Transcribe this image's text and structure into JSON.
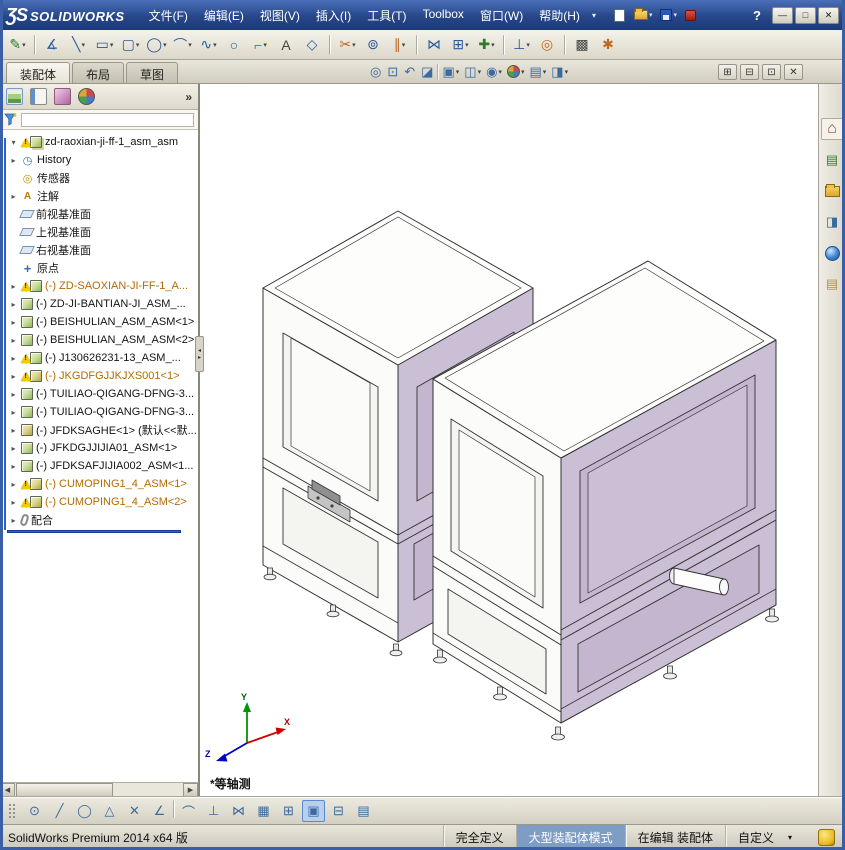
{
  "colors": {
    "titlebar_blue": "#27478a",
    "accent_blue": "#2f5fd0",
    "model_lavender": "#cbbfd6",
    "warning_yellow": "#f5c800"
  },
  "titlebar": {
    "logo_mark": "ƷS",
    "logo_text": "SOLIDWORKS",
    "menu_caret": "▾",
    "help_label": "?",
    "menus": [
      {
        "label": "文件(F)"
      },
      {
        "label": "编辑(E)"
      },
      {
        "label": "视图(V)"
      },
      {
        "label": "插入(I)"
      },
      {
        "label": "工具(T)"
      },
      {
        "label": "Toolbox"
      },
      {
        "label": "窗口(W)"
      },
      {
        "label": "帮助(H)"
      }
    ],
    "quick_icons": [
      {
        "name": "new-document-button",
        "cls": "qi-page",
        "caret": ""
      },
      {
        "name": "open-button",
        "cls": "qi-folder",
        "caret": "▾"
      },
      {
        "name": "save-button",
        "cls": "qi-floppy",
        "caret": "▾"
      },
      {
        "name": "record-status-icon",
        "cls": "qi-red",
        "caret": "",
        "inter": "false"
      }
    ],
    "window_buttons": [
      {
        "name": "minimize-button",
        "glyph": "—"
      },
      {
        "name": "maximize-button",
        "glyph": "□"
      },
      {
        "name": "close-button",
        "glyph": "✕"
      }
    ]
  },
  "toolbar": {
    "icons": [
      {
        "name": "sketch-button",
        "glyph": "✎",
        "caret": "▾",
        "cls": "c-green"
      },
      {
        "name": "toolbar-separator",
        "glyph": "",
        "caret": "",
        "cls": "sep",
        "inter": "false"
      },
      {
        "name": "smart-dimension-button",
        "glyph": "∡",
        "caret": "",
        "cls": "c-blue"
      },
      {
        "name": "line-button",
        "glyph": "╲",
        "caret": "▾",
        "cls": "c-blue"
      },
      {
        "name": "rectangle-button",
        "glyph": "▭",
        "caret": "▾",
        "cls": "c-blue"
      },
      {
        "name": "slot-button",
        "glyph": "▢",
        "caret": "▾",
        "cls": "c-blue"
      },
      {
        "name": "circle-button",
        "glyph": "◯",
        "caret": "▾",
        "cls": "c-blue"
      },
      {
        "name": "arc-button",
        "glyph": "⌒",
        "caret": "▾",
        "cls": "c-blue"
      },
      {
        "name": "spline-button",
        "glyph": "∿",
        "caret": "▾",
        "cls": "c-blue"
      },
      {
        "name": "ellipse-button",
        "glyph": "○",
        "caret": "",
        "cls": "c-blue"
      },
      {
        "name": "fillet-button",
        "glyph": "⌐",
        "caret": "▾",
        "cls": "c-orange"
      },
      {
        "name": "text-button",
        "glyph": "A",
        "caret": "",
        "cls": "c-dark"
      },
      {
        "name": "plane-button",
        "glyph": "◇",
        "caret": "",
        "cls": "c-blue"
      },
      {
        "name": "toolbar-separator",
        "glyph": "",
        "caret": "",
        "cls": "sep",
        "inter": "false"
      },
      {
        "name": "trim-entities-button",
        "glyph": "✂",
        "caret": "▾",
        "cls": "c-orange"
      },
      {
        "name": "convert-entities-button",
        "glyph": "⊚",
        "caret": "",
        "cls": "c-blue"
      },
      {
        "name": "offset-entities-button",
        "glyph": "∥",
        "caret": "▾",
        "cls": "c-orange"
      },
      {
        "name": "toolbar-separator",
        "glyph": "",
        "caret": "",
        "cls": "sep",
        "inter": "false"
      },
      {
        "name": "mirror-entities-button",
        "glyph": "⋈",
        "caret": "",
        "cls": "c-blue"
      },
      {
        "name": "linear-pattern-button",
        "glyph": "⊞",
        "caret": "▾",
        "cls": "c-blue"
      },
      {
        "name": "move-entities-button",
        "glyph": "✚",
        "caret": "▾",
        "cls": "c-green"
      },
      {
        "name": "toolbar-separator",
        "glyph": "",
        "caret": "",
        "cls": "sep",
        "inter": "false"
      },
      {
        "name": "display-relations-button",
        "glyph": "⊥",
        "caret": "▾",
        "cls": "c-blue"
      },
      {
        "name": "repair-sketch-button",
        "glyph": "◎",
        "caret": "",
        "cls": "c-orange"
      },
      {
        "name": "toolbar-separator",
        "glyph": "",
        "caret": "",
        "cls": "sep",
        "inter": "false"
      },
      {
        "name": "sketch-picture-button",
        "glyph": "▩",
        "caret": "",
        "cls": "c-dark"
      },
      {
        "name": "rapid-sketch-button",
        "glyph": "✱",
        "caret": "",
        "cls": "c-orange"
      }
    ]
  },
  "tabs": {
    "items": [
      {
        "label": "装配体",
        "cls": "active"
      },
      {
        "label": "布局",
        "cls": ""
      },
      {
        "label": "草图",
        "cls": ""
      }
    ]
  },
  "mdi_buttons": [
    {
      "name": "doc-new-window-button",
      "glyph": "⊞"
    },
    {
      "name": "doc-cascade-button",
      "glyph": "⊟"
    },
    {
      "name": "doc-restore-button",
      "glyph": "⊡"
    },
    {
      "name": "doc-close-button",
      "glyph": "✕"
    }
  ],
  "headsup": {
    "icons": [
      {
        "name": "zoom-fit-button",
        "glyph": "◎",
        "caret": "",
        "cls": ""
      },
      {
        "name": "zoom-area-button",
        "glyph": "⊡",
        "caret": "",
        "cls": ""
      },
      {
        "name": "previous-view-button",
        "glyph": "↶",
        "caret": "",
        "cls": ""
      },
      {
        "name": "section-view-button",
        "glyph": "◪",
        "caret": "",
        "cls": ""
      },
      {
        "name": "headsup-separator",
        "glyph": "",
        "caret": "",
        "cls": "sep",
        "inter": "false"
      },
      {
        "name": "view-orientation-button",
        "glyph": "▣",
        "caret": "▾",
        "cls": ""
      },
      {
        "name": "display-style-button",
        "glyph": "◫",
        "caret": "▾",
        "cls": ""
      },
      {
        "name": "hide-show-items-button",
        "glyph": "◉",
        "caret": "▾",
        "cls": ""
      },
      {
        "name": "edit-appearance-button",
        "glyph": "",
        "caret": "▾",
        "cls": "ball"
      },
      {
        "name": "apply-scene-button",
        "glyph": "▤",
        "caret": "▾",
        "cls": ""
      },
      {
        "name": "view-settings-button",
        "glyph": "◨",
        "caret": "▾",
        "cls": ""
      }
    ]
  },
  "panel_tabs": {
    "chevron": "»",
    "icons": [
      {
        "name": "featuremanager-tab",
        "cls": "pt-feat"
      },
      {
        "name": "propertymanager-tab",
        "cls": "pt-prop"
      },
      {
        "name": "configurationmanager-tab",
        "cls": "pt-conf"
      },
      {
        "name": "displaymanager-tab",
        "cls": "pt-disp"
      }
    ]
  },
  "tree": {
    "items": [
      {
        "arrow": "▾",
        "icon": "i-root",
        "cls": "warn",
        "label": "zd-raoxian-ji-ff-1_asm_asm"
      },
      {
        "arrow": "▸",
        "icon": "i-history",
        "cls": "",
        "label": "History"
      },
      {
        "arrow": "",
        "icon": "i-sensor",
        "cls": "",
        "label": "传感器"
      },
      {
        "arrow": "▸",
        "icon": "i-annot",
        "cls": "",
        "label": "注解"
      },
      {
        "arrow": "",
        "icon": "i-plane",
        "cls": "",
        "label": "前视基准面"
      },
      {
        "arrow": "",
        "icon": "i-plane",
        "cls": "",
        "label": "上视基准面"
      },
      {
        "arrow": "",
        "icon": "i-plane",
        "cls": "",
        "label": "右视基准面"
      },
      {
        "arrow": "",
        "icon": "i-origin",
        "cls": "",
        "label": "原点"
      },
      {
        "arrow": "▸",
        "icon": "i-asm",
        "cls": "warn orange",
        "label": "(-) ZD-SAOXIAN-JI-FF-1_A..."
      },
      {
        "arrow": "▸",
        "icon": "i-asm",
        "cls": "",
        "label": "(-) ZD-JI-BANTIAN-JI_ASM_..."
      },
      {
        "arrow": "▸",
        "icon": "i-asm",
        "cls": "",
        "label": "(-) BEISHULIAN_ASM_ASM<1>"
      },
      {
        "arrow": "▸",
        "icon": "i-asm",
        "cls": "",
        "label": "(-) BEISHULIAN_ASM_ASM<2>"
      },
      {
        "arrow": "▸",
        "icon": "i-asm",
        "cls": "warn",
        "label": "(-) J130626231-13_ASM_..."
      },
      {
        "arrow": "▸",
        "icon": "i-part",
        "cls": "warn orange",
        "label": "(-) JKGDFGJJKJXS001<1>"
      },
      {
        "arrow": "▸",
        "icon": "i-asm",
        "cls": "",
        "label": "(-) TUILIAO-QIGANG-DFNG-3..."
      },
      {
        "arrow": "▸",
        "icon": "i-asm",
        "cls": "",
        "label": "(-) TUILIAO-QIGANG-DFNG-3..."
      },
      {
        "arrow": "▸",
        "icon": "i-part",
        "cls": "",
        "label": "(-) JFDKSAGHE<1> (默认<<默..."
      },
      {
        "arrow": "▸",
        "icon": "i-asm",
        "cls": "",
        "label": "(-) JFKDGJJIJIA01_ASM<1>"
      },
      {
        "arrow": "▸",
        "icon": "i-asm",
        "cls": "",
        "label": "(-) JFDKSAFJIJIA002_ASM<1..."
      },
      {
        "arrow": "▸",
        "icon": "i-part",
        "cls": "warn orange",
        "label": "(-) CUMOPING1_4_ASM<1>"
      },
      {
        "arrow": "▸",
        "icon": "i-part",
        "cls": "warn orange",
        "label": "(-) CUMOPING1_4_ASM<2>"
      },
      {
        "arrow": "▸",
        "icon": "i-mates",
        "cls": "",
        "label": "配合"
      }
    ]
  },
  "taskpane": {
    "icons": [
      {
        "name": "resources-tab",
        "glyph": "⌂",
        "cls": "tp-home"
      },
      {
        "name": "design-library-tab",
        "glyph": "▤",
        "cls": "tp-lib"
      },
      {
        "name": "file-explorer-tab",
        "glyph": "",
        "cls": "tp-folder"
      },
      {
        "name": "view-palette-tab",
        "glyph": "◨",
        "cls": "tp-pal"
      },
      {
        "name": "appearances-scenes-tab",
        "glyph": "",
        "cls": "tp-globe"
      },
      {
        "name": "custom-properties-tab",
        "glyph": "▤",
        "cls": "tp-props"
      }
    ]
  },
  "viewport": {
    "view_label": "*等轴测",
    "triad": {
      "x": "X",
      "y": "Y",
      "z": "Z"
    }
  },
  "sketchbar": {
    "icons": [
      {
        "name": "select-tool",
        "glyph": "⊙",
        "cls": ""
      },
      {
        "name": "line-tool",
        "glyph": "╱",
        "cls": ""
      },
      {
        "name": "circle-tool",
        "glyph": "◯",
        "cls": ""
      },
      {
        "name": "polygon-tool",
        "glyph": "△",
        "cls": ""
      },
      {
        "name": "delete-relation-tool",
        "glyph": "✕",
        "cls": ""
      },
      {
        "name": "angle-tool",
        "glyph": "∠",
        "cls": ""
      },
      {
        "name": "sketchbar-separator",
        "glyph": "",
        "cls": "sep",
        "inter": "false"
      },
      {
        "name": "arc-tool",
        "glyph": "⌒",
        "cls": ""
      },
      {
        "name": "perpendicular-tool",
        "glyph": "⊥",
        "cls": ""
      },
      {
        "name": "mirror-tool",
        "glyph": "⋈",
        "cls": ""
      },
      {
        "name": "grid-tool",
        "glyph": "▦",
        "cls": ""
      },
      {
        "name": "snap-tool",
        "glyph": "⊞",
        "cls": ""
      },
      {
        "name": "normal-view-tool",
        "glyph": "▣",
        "cls": "selected"
      },
      {
        "name": "table-tool",
        "glyph": "⊟",
        "cls": ""
      },
      {
        "name": "annotation-tool",
        "glyph": "▤",
        "cls": ""
      }
    ]
  },
  "statusbar": {
    "product": "SolidWorks Premium 2014 x64 版",
    "defined": "完全定义",
    "assembly_mode": "大型装配体模式",
    "editing": "在编辑 装配体",
    "custom": "自定义",
    "custom_caret": "▾"
  }
}
